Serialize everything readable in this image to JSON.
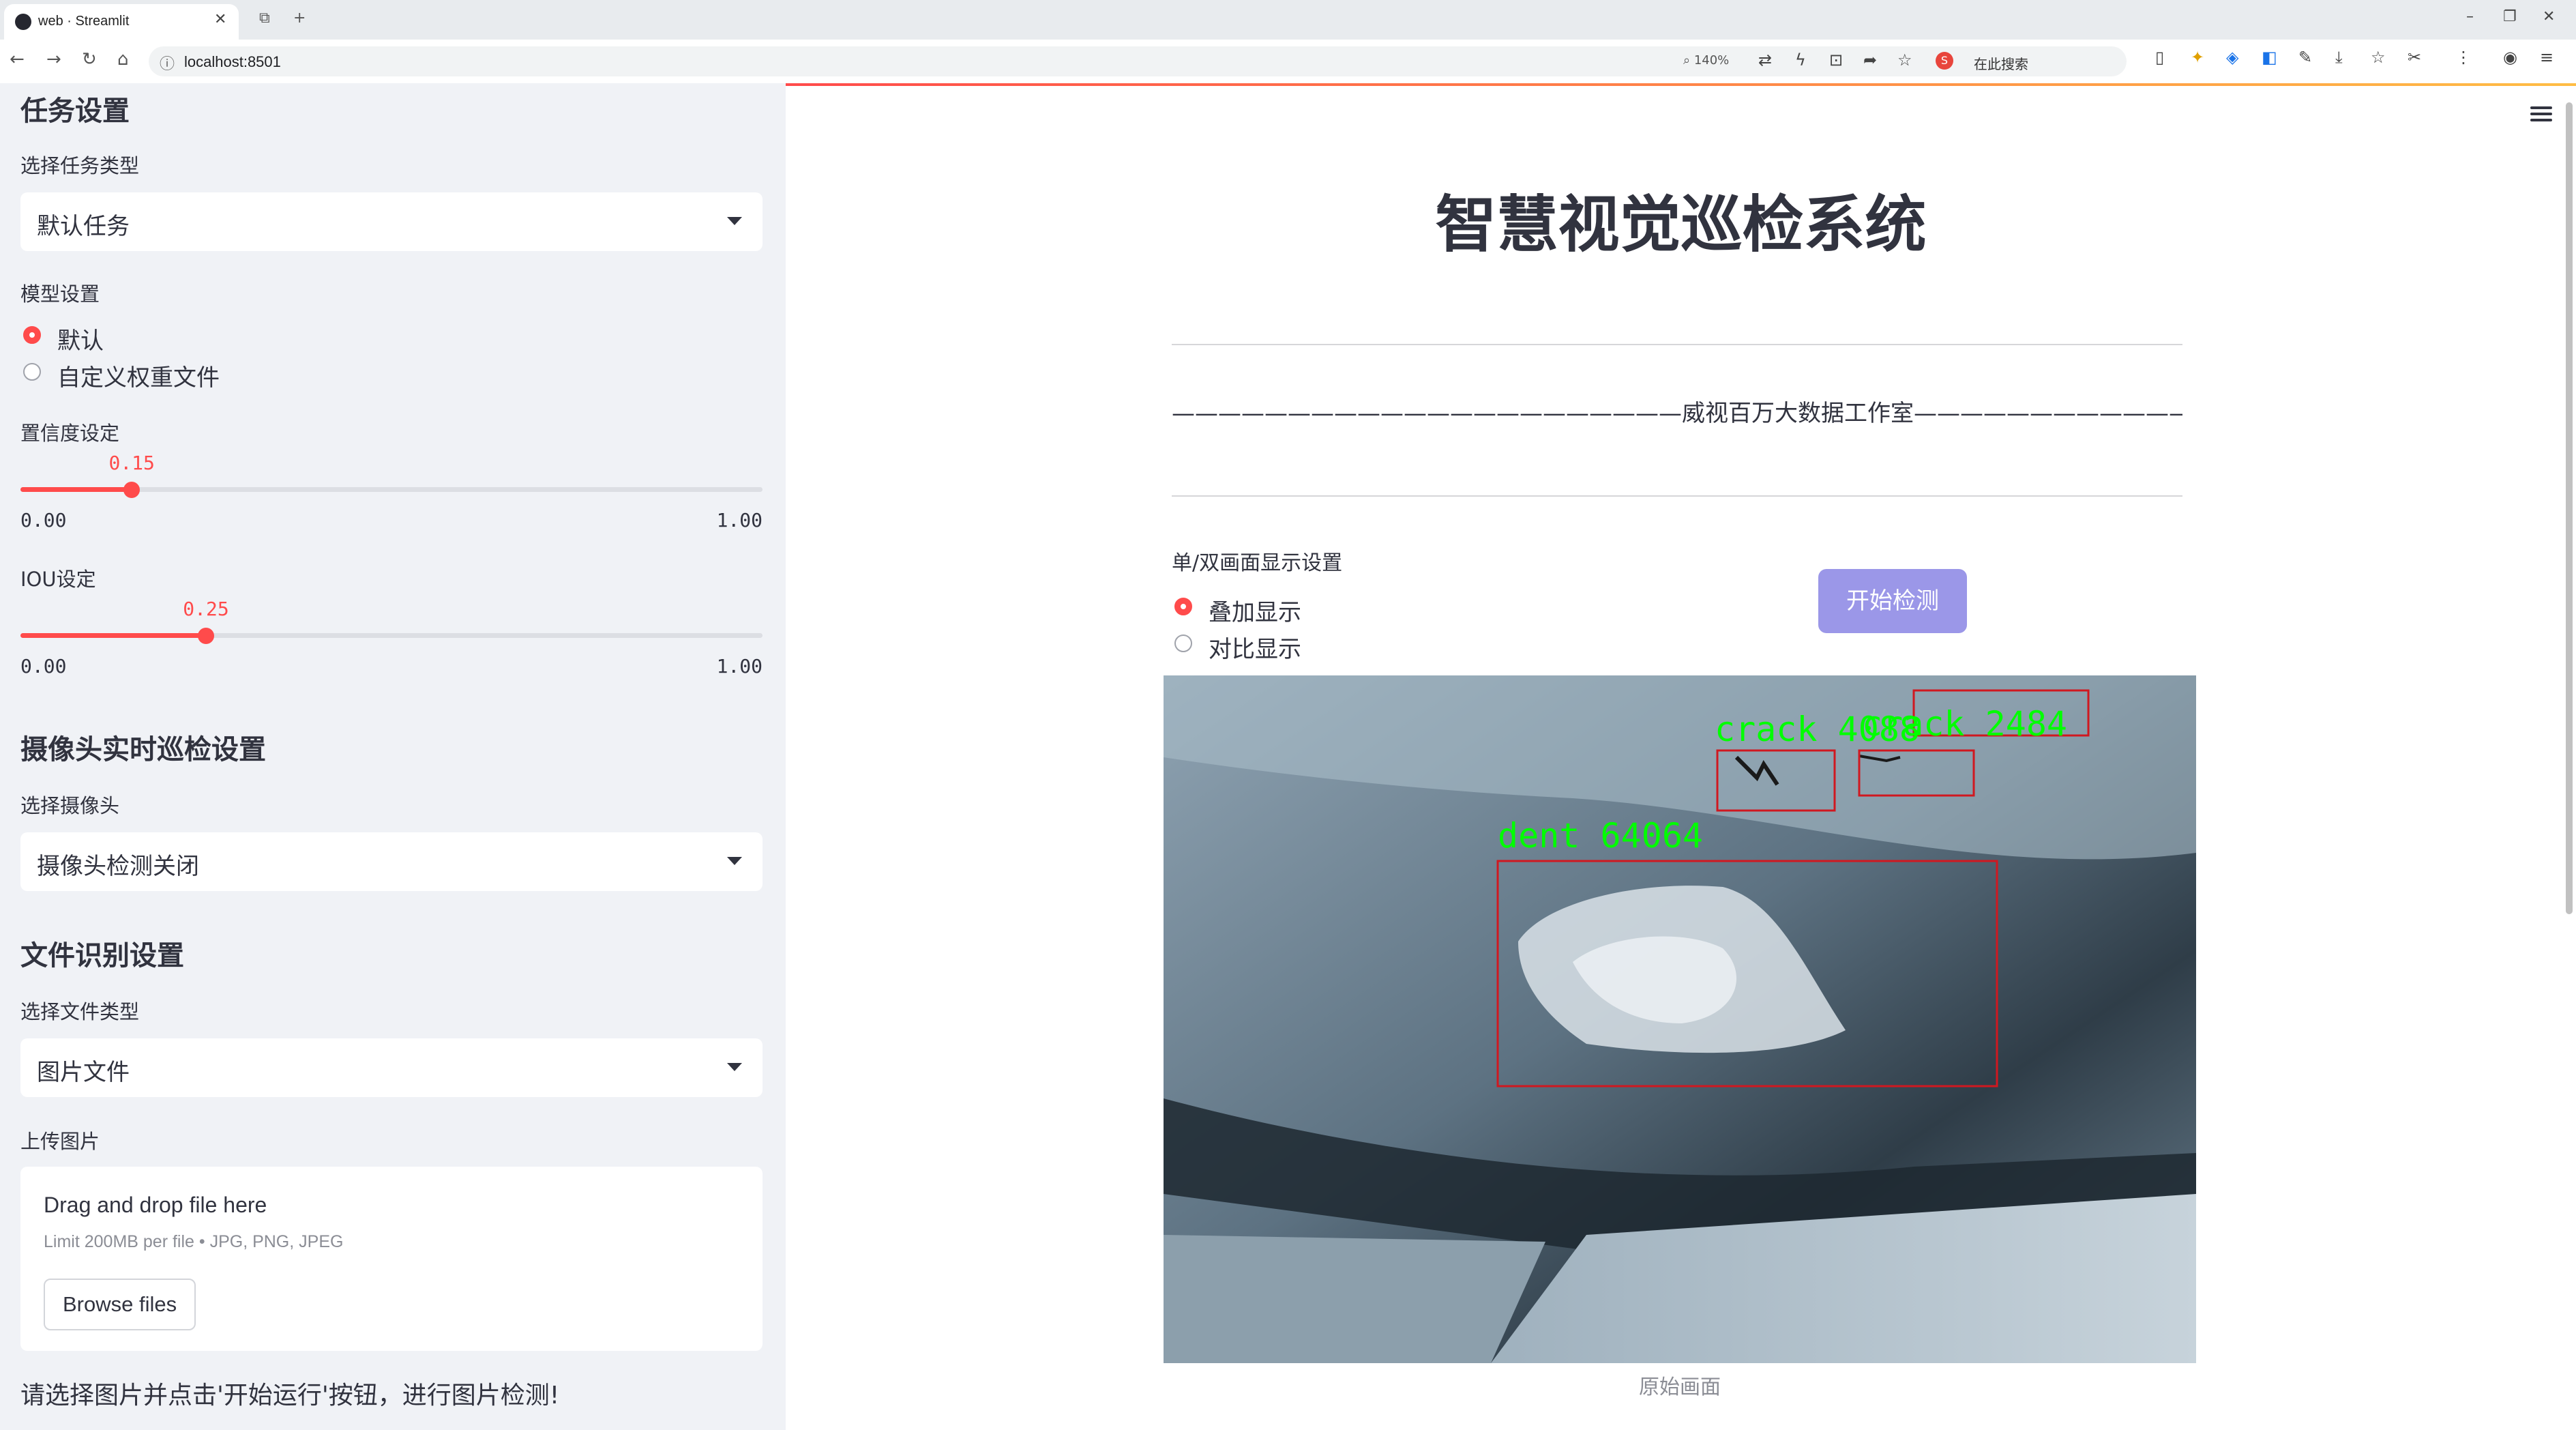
{
  "browser": {
    "tab_title": "web · Streamlit",
    "url": "localhost:8501",
    "zoom": "140%",
    "search_label": "在此搜索"
  },
  "sidebar": {
    "task_heading": "任务设置",
    "task_type_label": "选择任务类型",
    "task_type_value": "默认任务",
    "model_label": "模型设置",
    "model_options": [
      "默认",
      "自定义权重文件"
    ],
    "model_selected": "默认",
    "conf_label": "置信度设定",
    "conf": {
      "value": "0.15",
      "min": "0.00",
      "max": "1.00",
      "fraction": 0.15
    },
    "iou_label": "IOU设定",
    "iou": {
      "value": "0.25",
      "min": "0.00",
      "max": "1.00",
      "fraction": 0.25
    },
    "camera_heading": "摄像头实时巡检设置",
    "camera_label": "选择摄像头",
    "camera_value": "摄像头检测关闭",
    "file_heading": "文件识别设置",
    "file_type_label": "选择文件类型",
    "file_type_value": "图片文件",
    "upload_label": "上传图片",
    "upload_drag": "Drag and drop file here",
    "upload_limit": "Limit 200MB per file • JPG, PNG, JPEG",
    "upload_button": "Browse files",
    "note": "请选择图片并点击'开始运行'按钮，进行图片检测!"
  },
  "main": {
    "title": "智慧视觉巡检系统",
    "subtitle": "——————————————————————威视百万大数据工作室——————————————————————",
    "display_label": "单/双画面显示设置",
    "display_options": [
      "叠加显示",
      "对比显示"
    ],
    "display_selected": "叠加显示",
    "start_button": "开始检测",
    "image_caption": "原始画面",
    "detections": [
      {
        "label": "crack 4088",
        "color": "#00ff00"
      },
      {
        "label": "crack 2484",
        "color": "#00ff00"
      },
      {
        "label": "dent 64064",
        "color": "#00ff00"
      }
    ],
    "box_color": "#d01820"
  },
  "colors": {
    "accent": "#ff4b4b",
    "button": "#9b97e8",
    "sidebar_bg": "#f0f2f6"
  }
}
